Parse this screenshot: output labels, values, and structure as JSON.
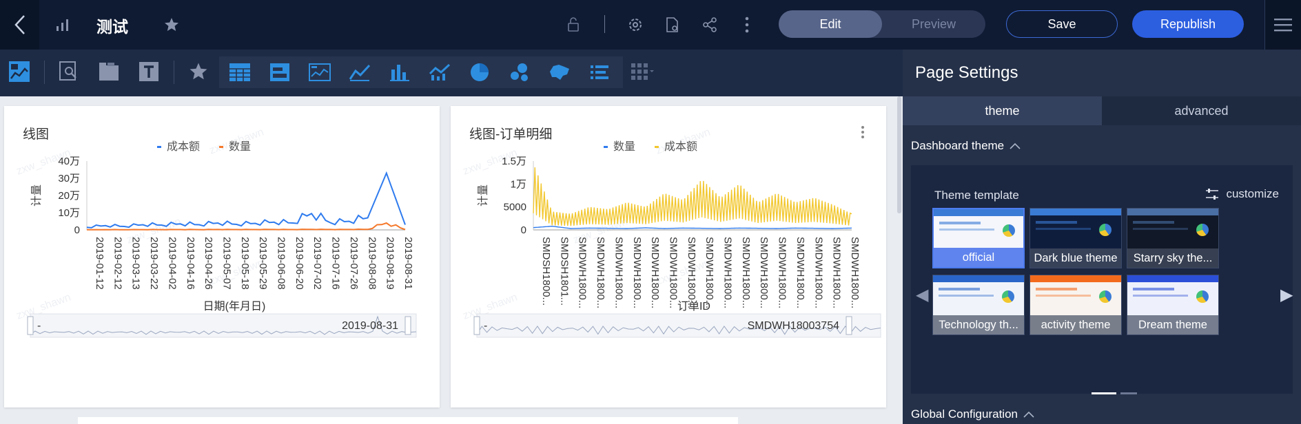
{
  "topbar": {
    "title": "测试",
    "mode_edit": "Edit",
    "mode_preview": "Preview",
    "save": "Save",
    "republish": "Republish"
  },
  "charts": [
    {
      "title": "线图",
      "watermark": "zxw_shawn",
      "legend": [
        "成本额",
        "数量"
      ],
      "xlabel": "日期(年月日)",
      "ylabel": "计量",
      "range_label_start": "-",
      "range_label_end": "2019-08-31"
    },
    {
      "title": "线图-订单明细",
      "watermark": "zxw_shawn",
      "legend": [
        "数量",
        "成本额"
      ],
      "xlabel": "订单ID",
      "ylabel": "计量",
      "range_label_start": "-",
      "range_label_end": "SMDWH18003754"
    }
  ],
  "chart_data": [
    {
      "type": "line",
      "title": "线图",
      "xlabel": "日期(年月日)",
      "ylabel": "计量",
      "ylim": [
        0,
        400000
      ],
      "yticks": [
        "0",
        "10万",
        "20万",
        "30万",
        "40万"
      ],
      "categories": [
        "2019-01-12",
        "2019-02-12",
        "2019-03-13",
        "2019-03-22",
        "2019-04-02",
        "2019-04-16",
        "2019-04-26",
        "2019-05-07",
        "2019-05-18",
        "2019-05-29",
        "2019-06-08",
        "2019-06-20",
        "2019-07-02",
        "2019-07-16",
        "2019-07-26",
        "2019-08-08",
        "2019-08-19",
        "2019-08-31"
      ],
      "series": [
        {
          "name": "成本额",
          "color": "#2f7bee",
          "values": [
            15000,
            25000,
            20000,
            30000,
            28000,
            35000,
            30000,
            40000,
            32000,
            38000,
            45000,
            40000,
            95000,
            42000,
            50000,
            70000,
            330000,
            30000
          ]
        },
        {
          "name": "数量",
          "color": "#f5782a",
          "values": [
            1000,
            1500,
            1200,
            1800,
            1500,
            2000,
            1800,
            2200,
            2000,
            2100,
            2300,
            2000,
            3000,
            2200,
            2500,
            3000,
            40000,
            2000
          ]
        }
      ],
      "legend": "top-center"
    },
    {
      "type": "line",
      "title": "线图-订单明细",
      "xlabel": "订单ID",
      "ylabel": "计量",
      "ylim": [
        0,
        15000
      ],
      "yticks": [
        "0",
        "5000",
        "1万",
        "1.5万"
      ],
      "categories": [
        "SMDSH1800...",
        "SMDSH1801...",
        "SMDWH1800...",
        "SMDWH1800...",
        "SMDWH1800...",
        "SMDWH1800...",
        "SMDWH1800...",
        "SMDWH1800...",
        "SMDWH1800...",
        "SMDWH1800...",
        "SMDWH1800...",
        "SMDWH1800...",
        "SMDWH1800...",
        "SMDWH1800...",
        "SMDWH1800...",
        "SMDWH1800...",
        "SMDWH1800...",
        "SMDWH1800..."
      ],
      "series": [
        {
          "name": "数量",
          "color": "#2f7bee",
          "values": [
            500,
            800,
            300,
            400,
            350,
            300,
            450,
            300,
            400,
            350,
            300,
            400,
            350,
            300,
            400,
            350,
            300,
            400
          ]
        },
        {
          "name": "成本额",
          "color": "#f2c72e",
          "values": [
            14500,
            4000,
            3500,
            5000,
            4500,
            6000,
            5000,
            8000,
            6500,
            11000,
            7000,
            10000,
            6000,
            8000,
            6000,
            7000,
            5500,
            3500
          ]
        }
      ],
      "legend": "top-center"
    }
  ],
  "panel": {
    "title": "Page Settings",
    "tab_theme": "theme",
    "tab_advanced": "advanced",
    "dashboard_theme": "Dashboard theme",
    "theme_template": "Theme template",
    "customize": "customize",
    "themes": [
      "official",
      "Dark blue theme",
      "Starry sky the...",
      "Technology th...",
      "activity theme",
      "Dream theme"
    ],
    "global_config": "Global Configuration"
  }
}
